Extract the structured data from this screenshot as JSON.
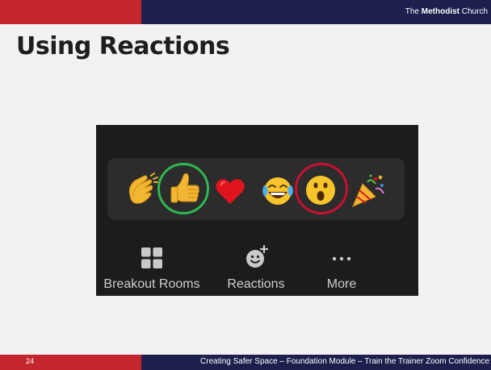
{
  "header": {
    "brand_prefix": "The ",
    "brand_bold": "Methodist",
    "brand_suffix": " Church"
  },
  "slide": {
    "title": "Using Reactions"
  },
  "zoom": {
    "reactions": [
      {
        "name": "clapping-hands",
        "highlighted": false
      },
      {
        "name": "thumbs-up",
        "highlighted": true,
        "highlight_color": "#2fb84f"
      },
      {
        "name": "red-heart",
        "highlighted": false
      },
      {
        "name": "tears-of-joy",
        "highlighted": false
      },
      {
        "name": "open-mouth",
        "highlighted": true,
        "highlight_color": "#c8102e"
      },
      {
        "name": "party-popper",
        "highlighted": false
      }
    ],
    "toolbar": {
      "breakout_rooms": "Breakout Rooms",
      "reactions": "Reactions",
      "more": "More"
    }
  },
  "footer": {
    "page_number": "24",
    "text": "Creating Safer Space – Foundation Module – Train the Trainer Zoom Confidence"
  },
  "colors": {
    "accent_red": "#c4262e",
    "navy": "#1d1f4d",
    "panel": "#1c1c1c",
    "tray": "#2c2c2c"
  }
}
